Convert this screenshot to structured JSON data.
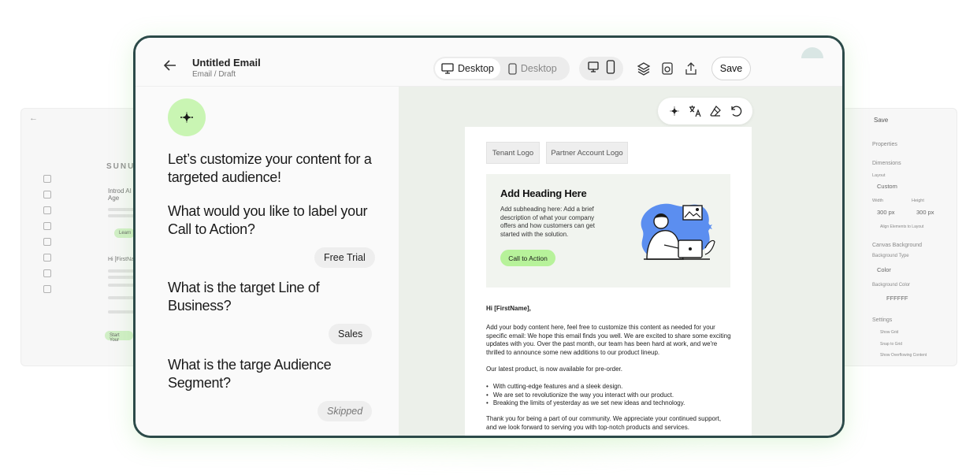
{
  "header": {
    "title": "Untitled Email",
    "breadcrumb": "Email / Draft",
    "view_desktop": "Desktop",
    "view_mobile": "Desktop",
    "save_label": "Save"
  },
  "chat": {
    "intro": "Let’s customize your content for a targeted audience!",
    "q1": "What would you like to label your Call to Action?",
    "a1": "Free Trial",
    "q2": "What is the target Line of Business?",
    "a2": "Sales",
    "q3": "What is the targe Audience Segment?",
    "a3": "Skipped"
  },
  "email": {
    "tenant_logo": "Tenant Logo",
    "partner_logo": "Partner Account Logo",
    "hero_heading": "Add Heading Here",
    "hero_sub": "Add subheading here: Add a brief description of what your company offers and how customers can get started with the solution.",
    "cta_label": "Call to Action",
    "greeting": "Hi [FirstName],",
    "para1": "Add your body content here, feel free to customize this content as needed for your specific email: We hope this email finds you well. We are excited to share some exciting updates with you. Over the past month, our team has been hard at work, and we're thrilled to announce some new additions to our product lineup.",
    "para2": "Our latest product, is now available for pre-order.",
    "bullets": [
      "With cutting-edge features and a sleek design.",
      "We are set to revolutionize the way you interact with our product.",
      "Breaking the limits of yesterday as we set new ideas and technology."
    ],
    "para3": "Thank you for being a part of our community. We appreciate your continued support, and we look forward to serving you with top-notch products and services."
  },
  "bg_left": {
    "logo": "SUNU",
    "heading": "Introd AI Age",
    "greeting": "Hi [FirstName",
    "button": "Learn",
    "button2": "Start Your"
  },
  "bg_right": {
    "save": "Save",
    "properties": "Properties",
    "dimensions": "Dimensions",
    "layout": "Layout",
    "layout_value": "Custom",
    "width": "Width",
    "height": "Height",
    "width_value": "300 px",
    "height_value": "300 px",
    "align": "Align Elements to Layout",
    "canvas_bg": "Canvas Background",
    "bg_type": "Background Type",
    "bg_type_value": "Color",
    "bg_color": "Background Color",
    "bg_color_value": "FFFFFF",
    "settings": "Settings",
    "show_grid": "Show Grid",
    "snap_grid": "Snap to Grid",
    "show_overflow": "Show Overflowing Content"
  },
  "colors": {
    "accent_green": "#b7f29a",
    "border": "#2c4a49"
  }
}
